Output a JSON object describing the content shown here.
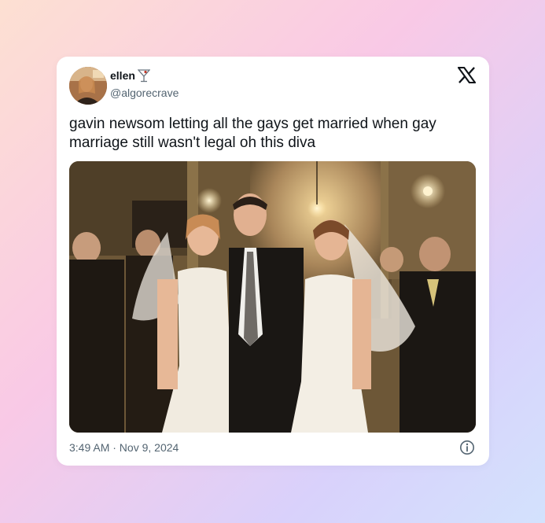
{
  "tweet": {
    "user_name": "ellen",
    "name_emoji_icon": "cocktail-glass-icon",
    "handle": "@algorecrave",
    "text": "gavin newsom letting all the gays get married when gay marriage still wasn't legal oh this diva",
    "timestamp": "3:49 AM · Nov 9, 2024",
    "platform_logo": "x-logo",
    "info_icon": "info-icon"
  },
  "photo": {
    "description_icon": "wedding-photo"
  }
}
